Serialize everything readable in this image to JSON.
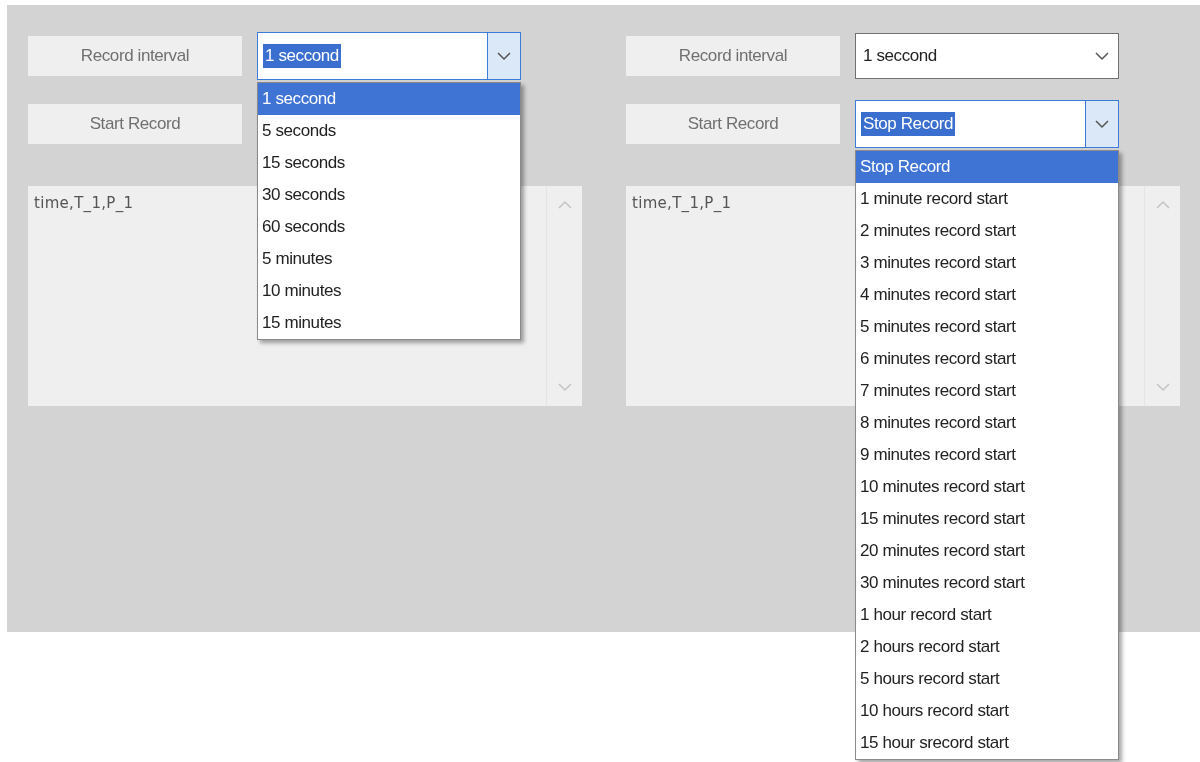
{
  "panels": [
    {
      "rows": [
        {
          "button": "Record interval",
          "combo": {
            "value": "1 seccond",
            "open": true,
            "options": [
              {
                "label": "1 seccond",
                "selected": true
              },
              {
                "label": "5 seconds",
                "selected": false
              },
              {
                "label": "15 seconds",
                "selected": false
              },
              {
                "label": "30 seconds",
                "selected": false
              },
              {
                "label": "60 seconds",
                "selected": false
              },
              {
                "label": "5 minutes",
                "selected": false
              },
              {
                "label": "10 minutes",
                "selected": false
              },
              {
                "label": "15 minutes",
                "selected": false
              }
            ]
          }
        },
        {
          "button": "Start Record"
        }
      ],
      "log": "time,T_1,P_1"
    },
    {
      "rows": [
        {
          "button": "Record interval",
          "combo": {
            "value": "1 seccond",
            "open": false
          }
        },
        {
          "button": "Start Record",
          "combo": {
            "value": "Stop Record",
            "open": true,
            "options": [
              {
                "label": "Stop Record",
                "selected": true
              },
              {
                "label": "1 minute record start",
                "selected": false
              },
              {
                "label": "2 minutes record start",
                "selected": false
              },
              {
                "label": "3 minutes record start",
                "selected": false
              },
              {
                "label": "4 minutes record start",
                "selected": false
              },
              {
                "label": "5 minutes record start",
                "selected": false
              },
              {
                "label": "6 minutes record start",
                "selected": false
              },
              {
                "label": "7 minutes record start",
                "selected": false
              },
              {
                "label": "8 minutes record start",
                "selected": false
              },
              {
                "label": "9 minutes record start",
                "selected": false
              },
              {
                "label": "10 minutes record start",
                "selected": false
              },
              {
                "label": "15 minutes record start",
                "selected": false
              },
              {
                "label": "20 minutes record start",
                "selected": false
              },
              {
                "label": "30 minutes record start",
                "selected": false
              },
              {
                "label": "1 hour record start",
                "selected": false
              },
              {
                "label": "2 hours record start",
                "selected": false
              },
              {
                "label": "5 hours record start",
                "selected": false
              },
              {
                "label": "10 hours record start",
                "selected": false
              },
              {
                "label": "15 hour srecord start",
                "selected": false
              }
            ]
          }
        }
      ],
      "log": "time,T_1,P_1"
    }
  ]
}
